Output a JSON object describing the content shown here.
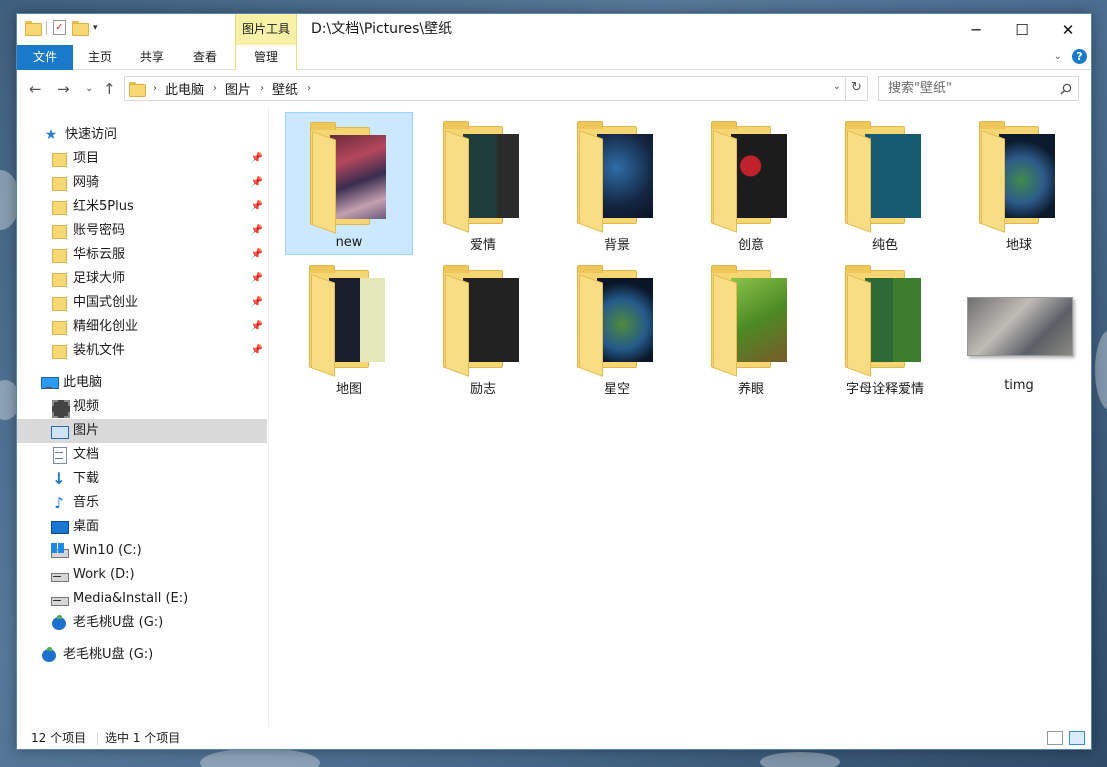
{
  "window": {
    "title": "D:\\文档\\Pictures\\壁纸",
    "tool_tab": "图片工具"
  },
  "ribbon": {
    "tabs": [
      "文件",
      "主页",
      "共享",
      "查看",
      "管理"
    ],
    "help": "?"
  },
  "address": {
    "crumbs": [
      "此电脑",
      "图片",
      "壁纸"
    ],
    "search_placeholder": "搜索\"壁纸\""
  },
  "nav": {
    "quick_access": "快速访问",
    "quick_items": [
      "项目",
      "网骑",
      "红米5Plus",
      "账号密码",
      "华标云服",
      "足球大师",
      "中国式创业",
      "精细化创业",
      "装机文件"
    ],
    "this_pc": "此电脑",
    "pc_items": [
      "视频",
      "图片",
      "文档",
      "下载",
      "音乐",
      "桌面",
      "Win10 (C:)",
      "Work (D:)",
      "Media&Install (E:)",
      "老毛桃U盘 (G:)"
    ],
    "usb_root": "老毛桃U盘 (G:)"
  },
  "files": [
    {
      "name": "new",
      "kind": "folder",
      "selected": true
    },
    {
      "name": "爱情",
      "kind": "folder"
    },
    {
      "name": "背景",
      "kind": "folder"
    },
    {
      "name": "创意",
      "kind": "folder"
    },
    {
      "name": "纯色",
      "kind": "folder"
    },
    {
      "name": "地球",
      "kind": "folder"
    },
    {
      "name": "地图",
      "kind": "folder"
    },
    {
      "name": "励志",
      "kind": "folder"
    },
    {
      "name": "星空",
      "kind": "folder"
    },
    {
      "name": "养眼",
      "kind": "folder"
    },
    {
      "name": "字母诠释爱情",
      "kind": "folder"
    },
    {
      "name": "timg",
      "kind": "image"
    }
  ],
  "status": {
    "count": "12 个项目",
    "selected": "选中 1 个项目"
  },
  "colors": {
    "accent": "#1979ca",
    "selection": "#cce8ff",
    "tool_tab": "#f8f2a8"
  }
}
